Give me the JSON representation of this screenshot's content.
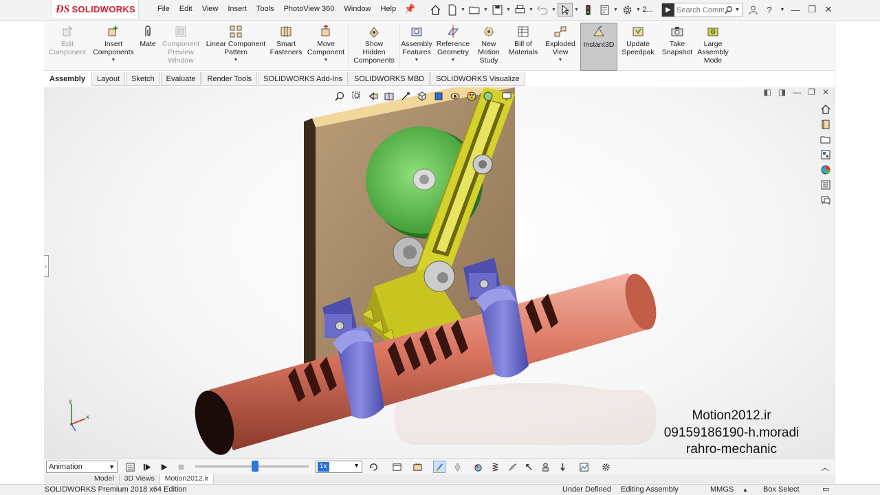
{
  "app": {
    "logo_ds": "ƉS",
    "logo_name": "SOLIDWORKS"
  },
  "menu": [
    "File",
    "Edit",
    "View",
    "Insert",
    "Tools",
    "PhotoView 360",
    "Window",
    "Help"
  ],
  "titlebar": {
    "quick_count": "2...",
    "search_badge": "▶",
    "search_placeholder": "Search Comm"
  },
  "commands": {
    "edit_component": [
      "Edit",
      "Component"
    ],
    "insert_components": [
      "Insert",
      "Components"
    ],
    "mate": [
      "Mate"
    ],
    "component_preview": [
      "Component",
      "Preview",
      "Window"
    ],
    "linear_pattern": [
      "Linear Component",
      "Pattern"
    ],
    "smart_fasteners": [
      "Smart",
      "Fasteners"
    ],
    "move_component": [
      "Move",
      "Component"
    ],
    "show_hidden": [
      "Show",
      "Hidden",
      "Components"
    ],
    "assembly_features": [
      "Assembly",
      "Features"
    ],
    "reference_geometry": [
      "Reference",
      "Geometry"
    ],
    "new_motion_study": [
      "New",
      "Motion",
      "Study"
    ],
    "bill_of_materials": [
      "Bill of",
      "Materials"
    ],
    "exploded_view": [
      "Exploded",
      "View"
    ],
    "instant3d": [
      "Instant3D"
    ],
    "update_speedpak": [
      "Update",
      "Speedpak"
    ],
    "take_snapshot": [
      "Take",
      "Snapshot"
    ],
    "large_assembly": [
      "Large",
      "Assembly",
      "Mode"
    ]
  },
  "tabs": [
    "Assembly",
    "Layout",
    "Sketch",
    "Evaluate",
    "Render Tools",
    "SOLIDWORKS Add-Ins",
    "SOLIDWORKS MBD",
    "SOLIDWORKS Visualize"
  ],
  "watermark": {
    "line1": "Motion2012.ir",
    "line2": "09159186190-h.moradi",
    "line3": "rahro-mechanic"
  },
  "motion": {
    "study_type": "Animation",
    "playback_speed": "1x"
  },
  "bottom_tabs": [
    "Model",
    "3D Views",
    "Motion2012.ir"
  ],
  "status": {
    "edition": "SOLIDWORKS Premium 2018 x64 Edition",
    "definition": "Under Defined",
    "mode": "Editing Assembly",
    "units": "MMGS",
    "select_mode": "Box Select"
  },
  "colors": {
    "brand_red": "#d1202f",
    "rack_red": "#d97560",
    "gear_green": "#5fbf50",
    "arm_yellow": "#d4d02c",
    "clamp_blue": "#7d7ed8",
    "plate_brown": "#a98d6a",
    "accent_blue": "#2a78d7"
  }
}
